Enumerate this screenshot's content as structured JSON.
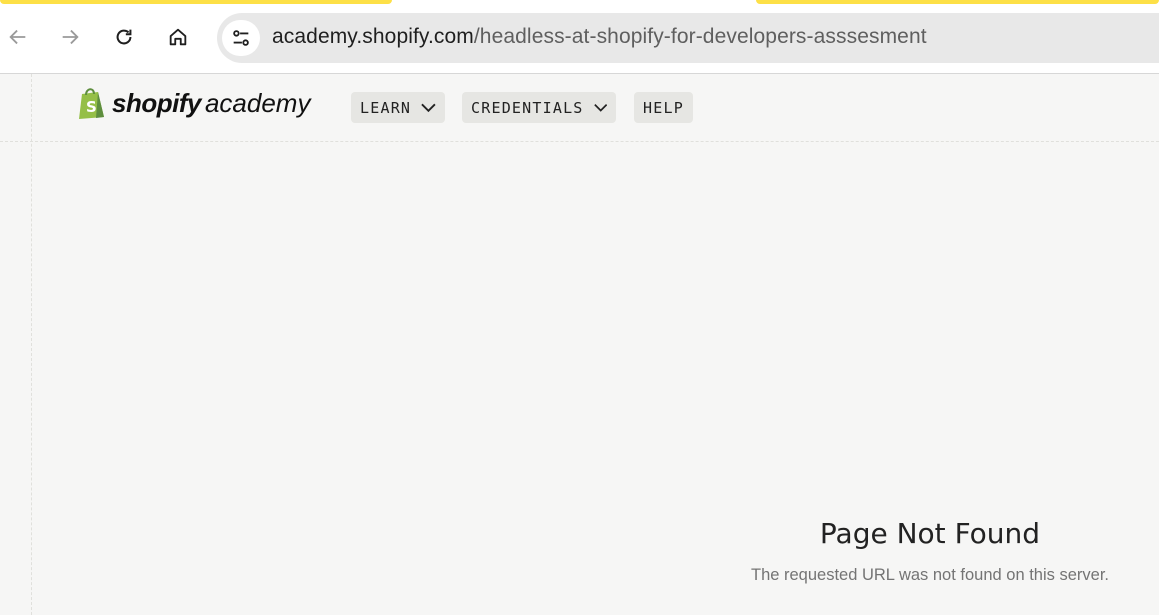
{
  "browser": {
    "url_host": "academy.shopify.com",
    "url_path": "/headless-at-shopify-for-developers-asssesment",
    "accent_color": "#fde047",
    "buttons": {
      "back_icon": "arrow-left-icon",
      "forward_icon": "arrow-right-icon",
      "reload_icon": "reload-icon",
      "home_icon": "home-icon",
      "site_info_icon": "tune-icon"
    }
  },
  "header": {
    "logo_bold": "shopify",
    "logo_light": "academy",
    "logo_bag_color": "#5e8e3e",
    "nav": {
      "learn": "LEARN",
      "credentials": "CREDENTIALS",
      "help": "HELP"
    }
  },
  "main": {
    "title": "Page Not Found",
    "message": "The requested URL was not found on this server."
  }
}
